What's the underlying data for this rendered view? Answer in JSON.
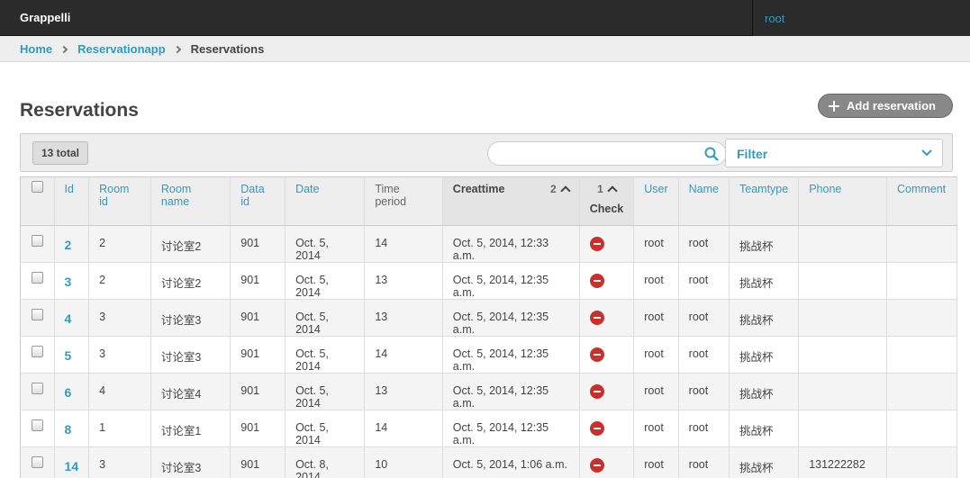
{
  "header": {
    "brand": "Grappelli",
    "user": "root"
  },
  "breadcrumb": {
    "items": [
      "Home",
      "Reservationapp"
    ],
    "current": "Reservations"
  },
  "page": {
    "title": "Reservations",
    "add_button": "Add reservation"
  },
  "toolbar": {
    "total": "13 total",
    "search_placeholder": "",
    "filter_label": "Filter"
  },
  "table": {
    "columns": {
      "id": "Id",
      "room_id": "Room id",
      "room_name": "Room name",
      "data_id": "Data id",
      "date": "Date",
      "time_period": "Time period",
      "creattime": "Creattime",
      "creattime_sort": "2",
      "check_sort": "1",
      "check": "Check",
      "user": "User",
      "name": "Name",
      "teamtype": "Teamtype",
      "phone": "Phone",
      "comment": "Comment"
    },
    "rows": [
      {
        "id": "2",
        "room_id": "2",
        "room_name": "讨论室2",
        "data_id": "901",
        "date": "Oct. 5, 2014",
        "time_period": "14",
        "creattime": "Oct. 5, 2014, 12:33 a.m.",
        "user": "root",
        "name": "root",
        "teamtype": "挑战杯",
        "phone": "",
        "comment": ""
      },
      {
        "id": "3",
        "room_id": "2",
        "room_name": "讨论室2",
        "data_id": "901",
        "date": "Oct. 5, 2014",
        "time_period": "13",
        "creattime": "Oct. 5, 2014, 12:35 a.m.",
        "user": "root",
        "name": "root",
        "teamtype": "挑战杯",
        "phone": "",
        "comment": ""
      },
      {
        "id": "4",
        "room_id": "3",
        "room_name": "讨论室3",
        "data_id": "901",
        "date": "Oct. 5, 2014",
        "time_period": "13",
        "creattime": "Oct. 5, 2014, 12:35 a.m.",
        "user": "root",
        "name": "root",
        "teamtype": "挑战杯",
        "phone": "",
        "comment": ""
      },
      {
        "id": "5",
        "room_id": "3",
        "room_name": "讨论室3",
        "data_id": "901",
        "date": "Oct. 5, 2014",
        "time_period": "14",
        "creattime": "Oct. 5, 2014, 12:35 a.m.",
        "user": "root",
        "name": "root",
        "teamtype": "挑战杯",
        "phone": "",
        "comment": ""
      },
      {
        "id": "6",
        "room_id": "4",
        "room_name": "讨论室4",
        "data_id": "901",
        "date": "Oct. 5, 2014",
        "time_period": "13",
        "creattime": "Oct. 5, 2014, 12:35 a.m.",
        "user": "root",
        "name": "root",
        "teamtype": "挑战杯",
        "phone": "",
        "comment": ""
      },
      {
        "id": "8",
        "room_id": "1",
        "room_name": "讨论室1",
        "data_id": "901",
        "date": "Oct. 5, 2014",
        "time_period": "14",
        "creattime": "Oct. 5, 2014, 12:35 a.m.",
        "user": "root",
        "name": "root",
        "teamtype": "挑战杯",
        "phone": "",
        "comment": ""
      },
      {
        "id": "14",
        "room_id": "3",
        "room_name": "讨论室3",
        "data_id": "901",
        "date": "Oct. 8, 2014",
        "time_period": "10",
        "creattime": "Oct. 5, 2014, 1:06 a.m.",
        "user": "root",
        "name": "root",
        "teamtype": "挑战杯",
        "phone": "131222282",
        "comment": ""
      }
    ]
  },
  "colors": {
    "accent": "#309bbf",
    "header_bg": "#2b2b2b",
    "check_icon": "#c9302c"
  },
  "icons": {
    "search": "search-icon",
    "filter_chevron": "chevron-down-icon",
    "check": "minus-circle-icon"
  }
}
